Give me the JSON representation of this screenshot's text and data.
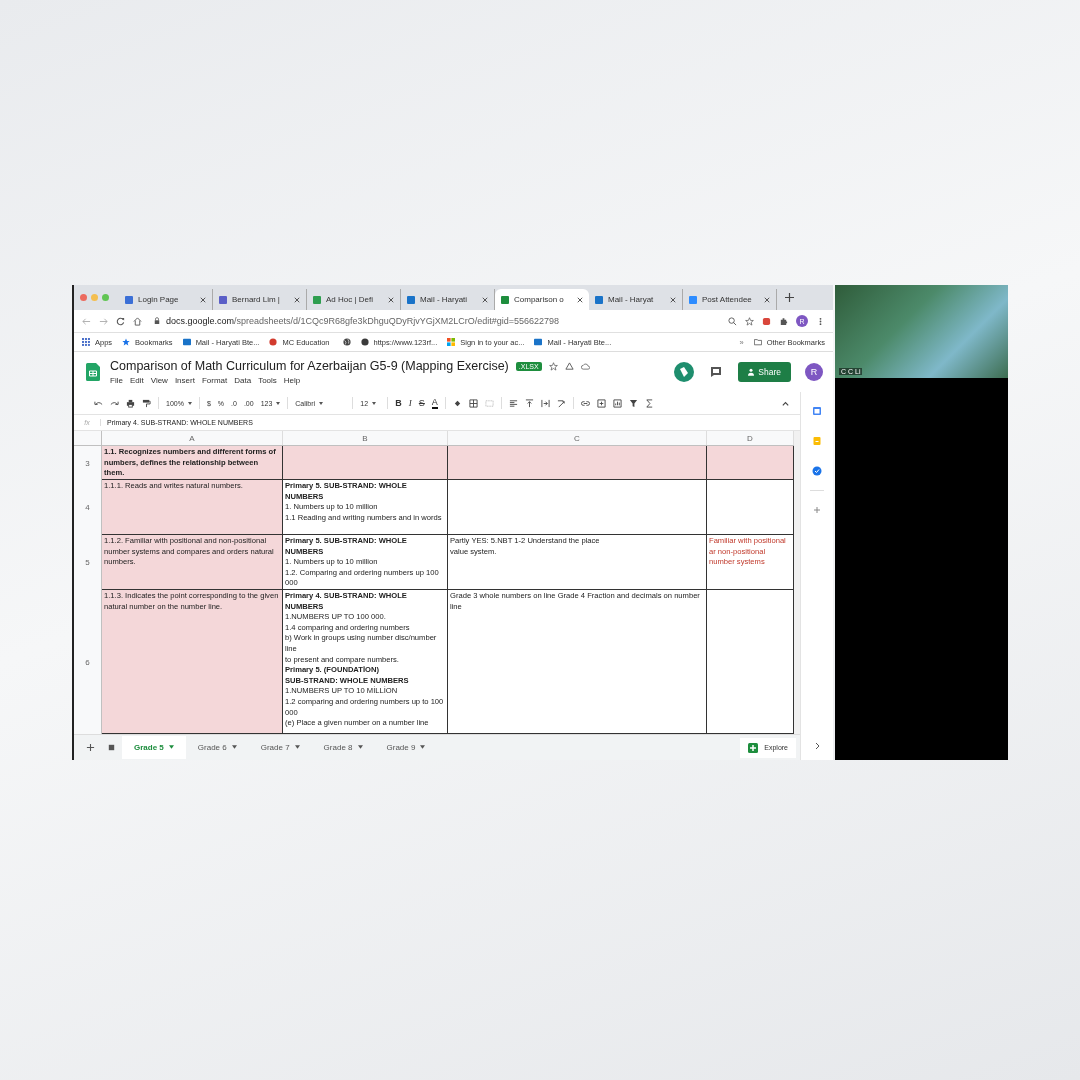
{
  "browser": {
    "tabs": [
      {
        "label": "Login Page",
        "selected": false,
        "color": "#3b6fd6"
      },
      {
        "label": "Bernard Lim |",
        "selected": false,
        "color": "#5b5fc7"
      },
      {
        "label": "Ad Hoc | Defi",
        "selected": false,
        "color": "#2e9e4f"
      },
      {
        "label": "Mail - Haryati",
        "selected": false,
        "color": "#1a73c8"
      },
      {
        "label": "Comparison o",
        "selected": true,
        "color": "#1e8e3e"
      },
      {
        "label": "Mail - Haryat",
        "selected": false,
        "color": "#1a73c8"
      },
      {
        "label": "Post Attendee",
        "selected": false,
        "color": "#2d8cff"
      }
    ],
    "address": {
      "host": "docs.google.com",
      "path": "/spreadsheets/d/1CQc9R68gfe3kDhguQDyRjvYGjXM2LCrO/edit#gid=556622798"
    },
    "profile": "R",
    "bookmarks": [
      "Apps",
      "Bookmarks",
      "Mail - Haryati Bte...",
      "MC Education",
      "https://www.123rf...",
      "Sign in to your ac...",
      "Mail - Haryati Bte..."
    ],
    "more_bookmarks": "»",
    "other_bookmarks": "Other Bookmarks"
  },
  "sheet": {
    "title": "Comparison of Math Curriculum for Azerbaijan G5-9 (Mapping Exercise)",
    "badge": ".XLSX",
    "menu": [
      "File",
      "Edit",
      "View",
      "Insert",
      "Format",
      "Data",
      "Tools",
      "Help"
    ],
    "share": "Share",
    "account": "R",
    "toolbar": {
      "zoom": "100%",
      "currency": "$",
      "percent": "%",
      "dec_less": ".0",
      "dec_more": ".00",
      "format": "123",
      "font": "Calibri",
      "size": "12",
      "bold": "B",
      "italic": "I",
      "strike": "S",
      "text_color": "A"
    },
    "formula_icon": "fx",
    "formula": "Primary 4. SUB-STRAND: WHOLE NUMBERS",
    "columns": [
      "A",
      "B",
      "C",
      "D"
    ],
    "rows": [
      {
        "number": "3",
        "cells": [
          {
            "text": "**1.1. Recognizes numbers and different forms of numbers, defines the relationship between them.**",
            "highlighted": true
          },
          {
            "text": "",
            "highlighted": true
          },
          {
            "text": "",
            "highlighted": true
          },
          {
            "text": "",
            "highlighted": true
          }
        ]
      },
      {
        "number": "4",
        "cells": [
          {
            "text": "1.1.1.  Reads and writes natural numbers.",
            "highlighted": true
          },
          {
            "text": "**Primary 5. SUB-STRAND: WHOLE NUMBERS**\n1. Numbers up to 10 million\n1.1 Reading and writing numbers and in words",
            "highlighted": false
          },
          {
            "text": "",
            "highlighted": false
          },
          {
            "text": "",
            "highlighted": false
          }
        ]
      },
      {
        "number": "5",
        "cells": [
          {
            "text": "1.1.2. Familiar with positional and non-positional number systems and compares and orders natural numbers.",
            "highlighted": true
          },
          {
            "text": "**Primary 5. SUB-STRAND: WHOLE NUMBERS**\n1. Numbers up to 10 million\n1.2. Comparing and ordering numbers  up 100 000",
            "highlighted": false
          },
          {
            "text": "Partly YES: 5.NBT 1-2 Understand the place\n value system.",
            "highlighted": false
          },
          {
            "text": "Familiar with positional ar non-positional number systems",
            "highlighted": false,
            "kind": "note"
          }
        ]
      },
      {
        "number": "6",
        "cells": [
          {
            "text": "1.1.3. Indicates the point corresponding to the given natural number on the number line.",
            "highlighted": true
          },
          {
            "text": "**Primary 4. SUB-STRAND: WHOLE NUMBERS**\n1.NUMBERS UP TO 100 000.\n1.4 comparing and ordering numbers\nb) Work in groups using number disc/number line\nto present and compare numbers.\n**Primary 5. (FOUNDATİON)**\n**SUB-STRAND: WHOLE NUMBERS**\n1.NUMBERS UP TO 10 MİLLİON\n1.2       comparing and ordering numbers up to 100 000\n(e)  Place a given number on a number line",
            "highlighted": false
          },
          {
            "text": "Grade 3 whole numbers on line Grade 4 Fraction and decimals on number line",
            "highlighted": false
          },
          {
            "text": "",
            "highlighted": false
          }
        ]
      }
    ],
    "sheet_tabs": [
      {
        "label": "Grade 5",
        "selected": true
      },
      {
        "label": "Grade 6",
        "selected": false
      },
      {
        "label": "Grade 7",
        "selected": false
      },
      {
        "label": "Grade 8",
        "selected": false
      },
      {
        "label": "Grade 9",
        "selected": false
      }
    ],
    "explore": "Explore"
  },
  "video": {
    "name": "C C Li"
  }
}
